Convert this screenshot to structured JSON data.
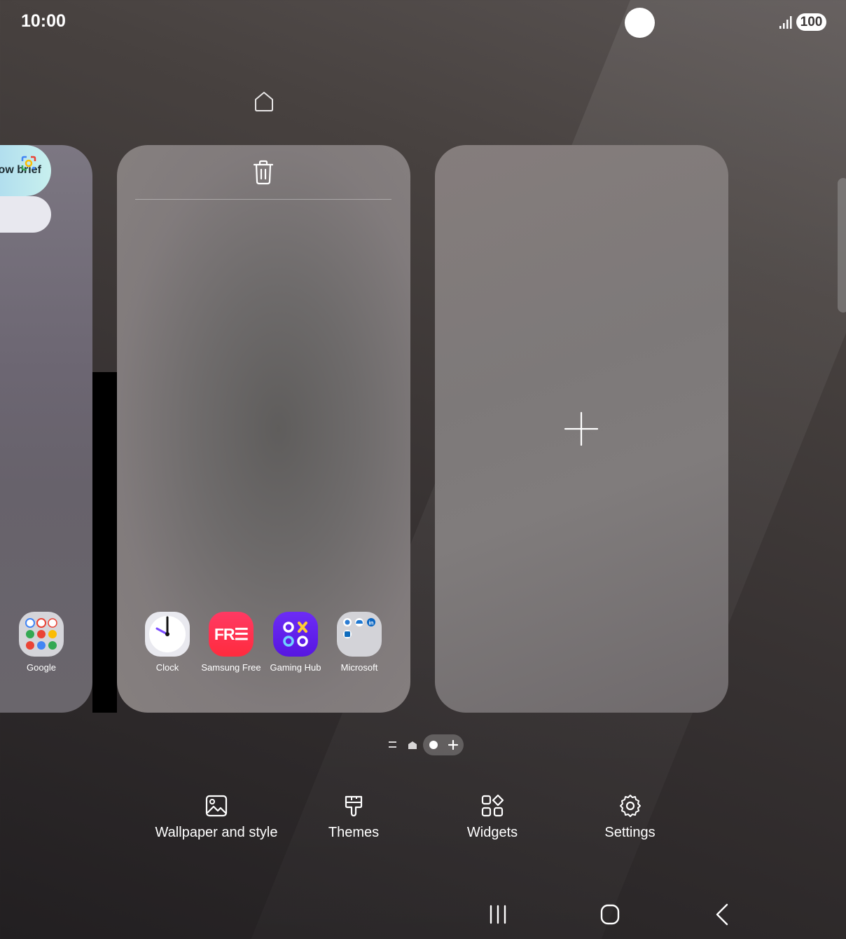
{
  "status_bar": {
    "time": "10:00",
    "battery": "100"
  },
  "left_page": {
    "now_brief_label": "Now brief",
    "folder_label": "Google"
  },
  "middle_page": {
    "apps": [
      {
        "label": "Clock",
        "icon": "clock-icon"
      },
      {
        "label": "Samsung Free",
        "icon": "samsung-free-icon",
        "icon_text": "FR☰"
      },
      {
        "label": "Gaming Hub",
        "icon": "gaming-hub-icon"
      },
      {
        "label": "Microsoft",
        "icon": "microsoft-folder-icon"
      }
    ]
  },
  "menu": {
    "wallpaper": "Wallpaper and style",
    "themes": "Themes",
    "widgets": "Widgets",
    "settings": "Settings"
  },
  "colors": {
    "free_red": "#ff2b4a",
    "gaming_purple": "#6223ee",
    "brief_gradient": [
      "#9fd0ef",
      "#c8f0ee"
    ]
  }
}
